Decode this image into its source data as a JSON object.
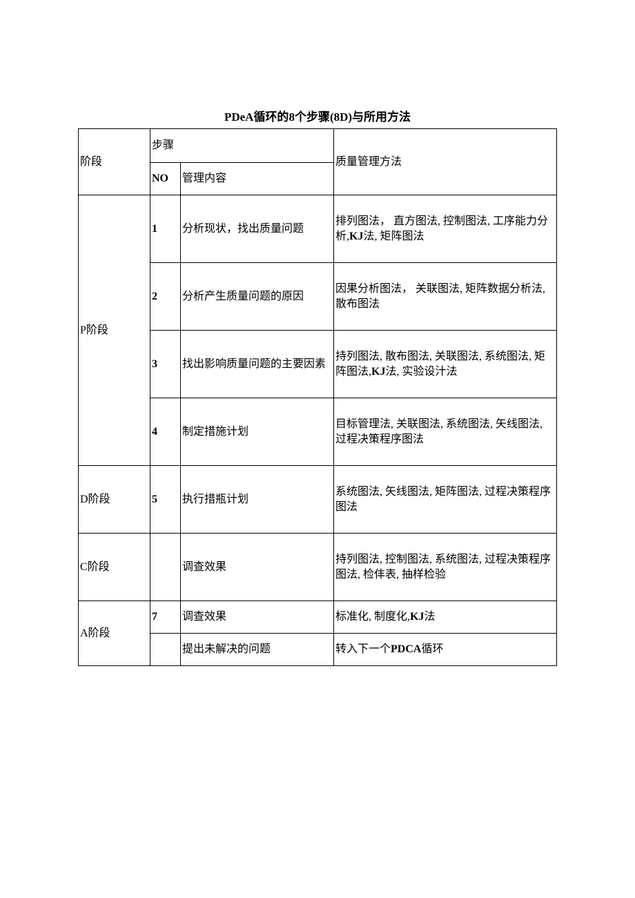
{
  "title_html": "<span class='bold'>PDeA</span>循环的<span class='bold'>8</span>个步骤<span class='bold'>(8D)</span>与所用方法",
  "header": {
    "phase": "阶段",
    "step": "步骤",
    "no": "NO",
    "content": "管理内容",
    "method": "质量管理方法"
  },
  "phases": {
    "p": "P阶段",
    "d": "D阶段",
    "c": "C阶段",
    "a": "A阶段"
  },
  "rows": {
    "p1": {
      "no": "1",
      "content": "分析现状，找出质量问题",
      "method_html": "排列图法， 直方图法, 控制图法, 工序能力分析,<span class='bold'>KJ</span>法, 矩阵图法"
    },
    "p2": {
      "no": "2",
      "content": "分析产生质量问题的原因",
      "method": "因果分析图法， 关联图法, 矩阵数据分析法, 散布图法"
    },
    "p3": {
      "no": "3",
      "content": "找出影响质量问题的主要因素",
      "method_html": "持列图法, 散布图法, 关联图法, 系统图法, 矩阵图法,<span class='bold'>KJ</span>法, 实验设汁法"
    },
    "p4": {
      "no": "4",
      "content": "制定措施计划",
      "method": "目标管理法, 关联图法,  系统图法, 矢线图法, 过程决策程序图法"
    },
    "d": {
      "no": "5",
      "content": "执行措瓶计划",
      "method": "系统图法, 矢线图法, 矩阵图法, 过程决策程序图法"
    },
    "c": {
      "no": "",
      "content": "调查效果",
      "method": "持列图法, 控制图法, 系统图法, 过程决策程序图法, 检仹表, 抽样检验"
    },
    "a1": {
      "no": "7",
      "content": "调查效果",
      "method_html": "标准化, 制度化,<span class='bold'>KJ</span>法"
    },
    "a2": {
      "no": "",
      "content": "提出未解决的问题",
      "method_html": "转入下一个<span class='bold'>PDCA</span>循环"
    }
  }
}
